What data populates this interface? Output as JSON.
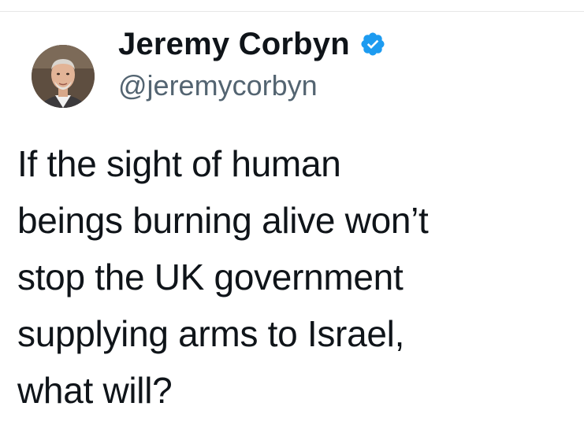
{
  "tweet": {
    "author": {
      "display_name": "Jeremy Corbyn",
      "handle": "@jeremycorbyn",
      "verified": true,
      "verified_icon": "verified-badge-icon",
      "badge_color": "#1d9bf0"
    },
    "text_lines": [
      "If the sight of human",
      "beings burning alive won’t",
      "stop the UK government",
      "supplying arms to Israel,",
      "what will?"
    ]
  }
}
